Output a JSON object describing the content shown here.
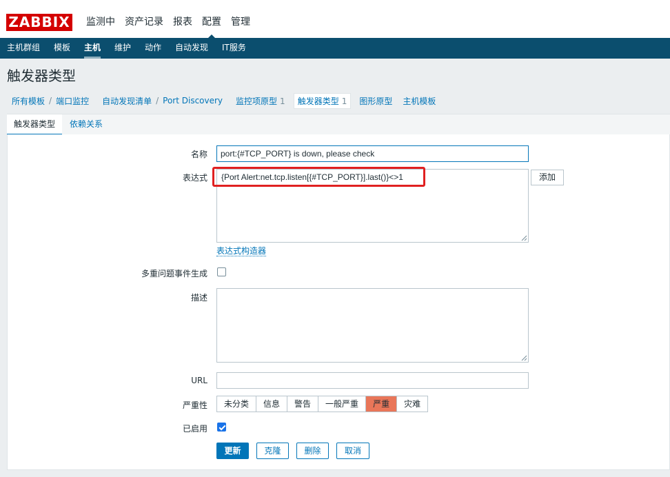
{
  "brand": {
    "logo_text": "ZABBIX",
    "logo_color": "#d40000",
    "nav_color": "#0b4e6e",
    "accent": "#0275b8"
  },
  "main_menu": [
    "监测中",
    "资产记录",
    "报表",
    "配置",
    "管理"
  ],
  "main_menu_active": "配置",
  "sub_menu": [
    "主机群组",
    "模板",
    "主机",
    "维护",
    "动作",
    "自动发现",
    "IT服务"
  ],
  "sub_menu_active": "主机",
  "page_title": "触发器类型",
  "breadcrumb": {
    "all_templates": "所有模板",
    "sep": "/",
    "template": "端口监控",
    "discovery_list": "自动发现清单",
    "discovery_rule": "Port Discovery",
    "item_prototypes": "监控项原型",
    "item_prototypes_count": "1",
    "trigger_prototypes": "触发器类型",
    "trigger_prototypes_count": "1",
    "graph_prototypes": "图形原型",
    "host_prototypes": "主机模板"
  },
  "tabs": {
    "trigger": "触发器类型",
    "dependencies": "依赖关系"
  },
  "form": {
    "name_label": "名称",
    "name_value": "port:{#TCP_PORT} is down, please check",
    "expression_label": "表达式",
    "expression_value": "{Port Alert:net.tcp.listen[{#TCP_PORT}].last()}<>1",
    "add_button": "添加",
    "expression_constructor": "表达式构造器",
    "multiple_events_label": "多重问题事件生成",
    "description_label": "描述",
    "description_value": "",
    "url_label": "URL",
    "url_value": "",
    "severity_label": "严重性",
    "severity_options": [
      "未分类",
      "信息",
      "警告",
      "一般严重",
      "严重",
      "灾难"
    ],
    "severity_selected": "严重",
    "severity_selected_color": "#e97659",
    "enabled_label": "已启用",
    "enabled": true,
    "multiple_events": false
  },
  "actions": {
    "update": "更新",
    "clone": "克隆",
    "delete": "删除",
    "cancel": "取消"
  }
}
